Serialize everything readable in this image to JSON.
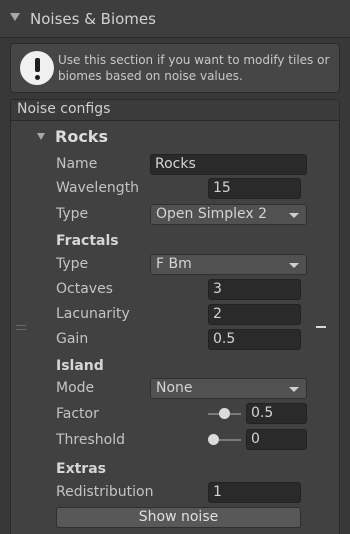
{
  "header": {
    "title": "Noises & Biomes"
  },
  "helpbox": {
    "message": "Use this section if you want to modify tiles or biomes based on noise values."
  },
  "list": {
    "title": "Noise configs"
  },
  "element": {
    "title": "Rocks",
    "name_label": "Name",
    "name_value": "Rocks",
    "wavelength_label": "Wavelength",
    "wavelength_value": "15",
    "type_label": "Type",
    "type_value": "Open Simplex 2",
    "fractals": {
      "title": "Fractals",
      "type_label": "Type",
      "type_value": "F Bm",
      "octaves_label": "Octaves",
      "octaves_value": "3",
      "lacunarity_label": "Lacunarity",
      "lacunarity_value": "2",
      "gain_label": "Gain",
      "gain_value": "0.5"
    },
    "island": {
      "title": "Island",
      "mode_label": "Mode",
      "mode_value": "None",
      "factor_label": "Factor",
      "factor_value": "0.5",
      "threshold_label": "Threshold",
      "threshold_value": "0"
    },
    "extras": {
      "title": "Extras",
      "redistribution_label": "Redistribution",
      "redistribution_value": "1",
      "show_noise_label": "Show noise"
    }
  }
}
